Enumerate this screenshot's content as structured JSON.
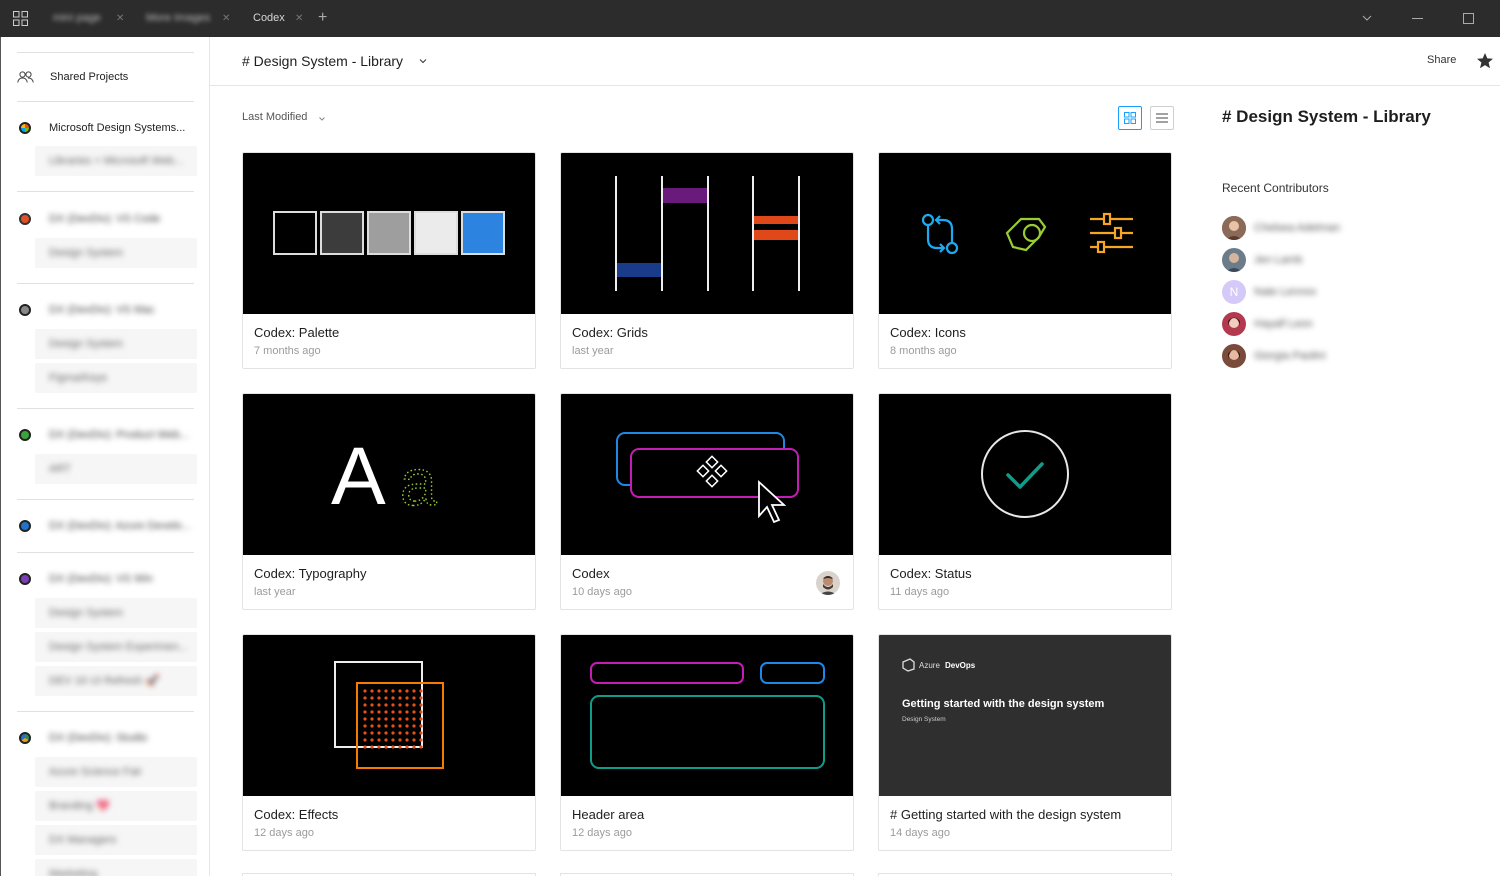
{
  "titlebar": {
    "tabs": [
      {
        "label": "mini page",
        "blurred": true
      },
      {
        "label": "More Images",
        "blurred": true
      },
      {
        "label": "Codex",
        "blurred": false
      }
    ],
    "add_tab": "+"
  },
  "sidebar": {
    "shared_projects": "Shared Projects",
    "teams": [
      {
        "label": "Microsoft Design Systems...",
        "color": "#2b6cd1",
        "blurred": false,
        "items": [
          "Libraries + Microsoft Web..."
        ]
      },
      {
        "label": "DX (DevDiv): VS Code",
        "color": "#e0512a",
        "blurred": true,
        "items": [
          "Design System"
        ]
      },
      {
        "label": "DX (DevDiv): VS Mac",
        "color": "#444444",
        "blurred": true,
        "items": [
          "Design System",
          "Figma/Keys"
        ]
      },
      {
        "label": "DX (DevDiv): Product Web...",
        "color": "#3aa33a",
        "blurred": true,
        "items": [
          "ART"
        ]
      },
      {
        "label": "DX (DevDiv): Azure Develo...",
        "color": "#1f73c9",
        "blurred": true,
        "items": []
      },
      {
        "label": "DX (DevDiv): VS Win",
        "color": "#7a3fb5",
        "blurred": true,
        "items": [
          "Design System",
          "Design System Experimen...",
          "DEV 16 UI Refresh 🚀"
        ]
      },
      {
        "label": "DX (DevDiv): Studio",
        "color": "#2e8b57",
        "blurred": true,
        "items": [
          "Azure Science Fair",
          "Branding 💖",
          "DX Managers",
          "Marketing"
        ]
      }
    ]
  },
  "header": {
    "title": "# Design System - Library",
    "share": "Share"
  },
  "toolbar": {
    "sort_label": "Last Modified"
  },
  "cards": [
    {
      "title": "Codex: Palette",
      "date": "7 months ago",
      "thumb": "palette"
    },
    {
      "title": "Codex: Grids",
      "date": "last year",
      "thumb": "grids"
    },
    {
      "title": "Codex: Icons",
      "date": "8 months ago",
      "thumb": "icons"
    },
    {
      "title": "Codex: Typography",
      "date": "last year",
      "thumb": "typography"
    },
    {
      "title": "Codex",
      "date": "10 days ago",
      "thumb": "codex",
      "has_avatar": true
    },
    {
      "title": "Codex: Status",
      "date": "11 days ago",
      "thumb": "status"
    },
    {
      "title": "Codex: Effects",
      "date": "12 days ago",
      "thumb": "effects"
    },
    {
      "title": "Header area",
      "date": "12 days ago",
      "thumb": "header"
    },
    {
      "title": "# Getting started with the design system",
      "date": "14 days ago",
      "thumb": "azure"
    }
  ],
  "azure_thumb": {
    "brand_prefix": "Azure",
    "brand_name": "DevOps",
    "heading": "Getting started with the design system",
    "subheading": "Design System"
  },
  "thumb_glyphs": {
    "typography_upper": "A",
    "typography_lower": "a"
  },
  "right_panel": {
    "title": "# Design System - Library",
    "contributors_heading": "Recent Contributors",
    "contributors": [
      {
        "name": "Chelsea Adelman",
        "avatar_color": "#a46b52"
      },
      {
        "name": "Jen Lamb",
        "avatar_color": "#6b7c8a"
      },
      {
        "name": "Nate Lennox",
        "avatar_color": "#c7b8f5",
        "initial": "N"
      },
      {
        "name": "Hayalf Leon",
        "avatar_color": "#b33a4e"
      },
      {
        "name": "Giorgia Paolini",
        "avatar_color": "#7a4a3a"
      }
    ]
  }
}
